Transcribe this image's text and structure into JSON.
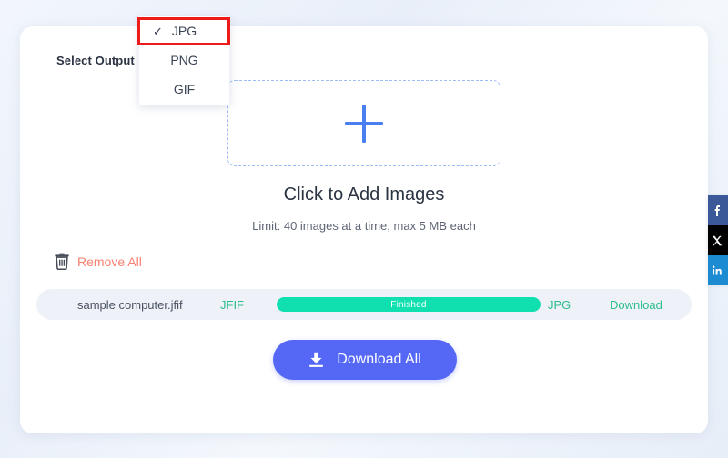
{
  "page": {
    "background_color": "#eef3fb",
    "card_color": "#ffffff"
  },
  "toolbar": {
    "select_output_label": "Select Output"
  },
  "dropdown": {
    "items": [
      {
        "label": "JPG",
        "selected": true,
        "check_glyph": "✓"
      },
      {
        "label": "PNG",
        "selected": false,
        "check_glyph": ""
      },
      {
        "label": "GIF",
        "selected": false,
        "check_glyph": ""
      }
    ],
    "highlight_color": "#ee1b1b"
  },
  "dropzone": {
    "plus_icon": "plus-icon",
    "title": "Click to Add Images",
    "subtitle": "Limit: 40 images at a time, max 5 MB each",
    "border_color": "#9dbcf5",
    "plus_color": "#4a7ff0"
  },
  "actions": {
    "remove_all_label": "Remove All",
    "remove_all_color": "#fa8072",
    "trash_icon": "trash-icon"
  },
  "file_row": {
    "name": "sample computer.jfif",
    "source_format": "JFIF",
    "progress_label": "Finished",
    "progress_percent": 100,
    "output_format": "JPG",
    "download_label": "Download",
    "accent_color": "#2bbd8a",
    "progress_color": "#10e0b0",
    "row_background": "#eef1f8"
  },
  "download_all": {
    "label": "Download All",
    "icon": "download-icon",
    "color": "#5468f5"
  },
  "share_rail": {
    "buttons": [
      {
        "name": "facebook",
        "color": "#3b5998"
      },
      {
        "name": "x-twitter",
        "color": "#000000"
      },
      {
        "name": "linkedin",
        "color": "#1d8bd1"
      }
    ]
  }
}
